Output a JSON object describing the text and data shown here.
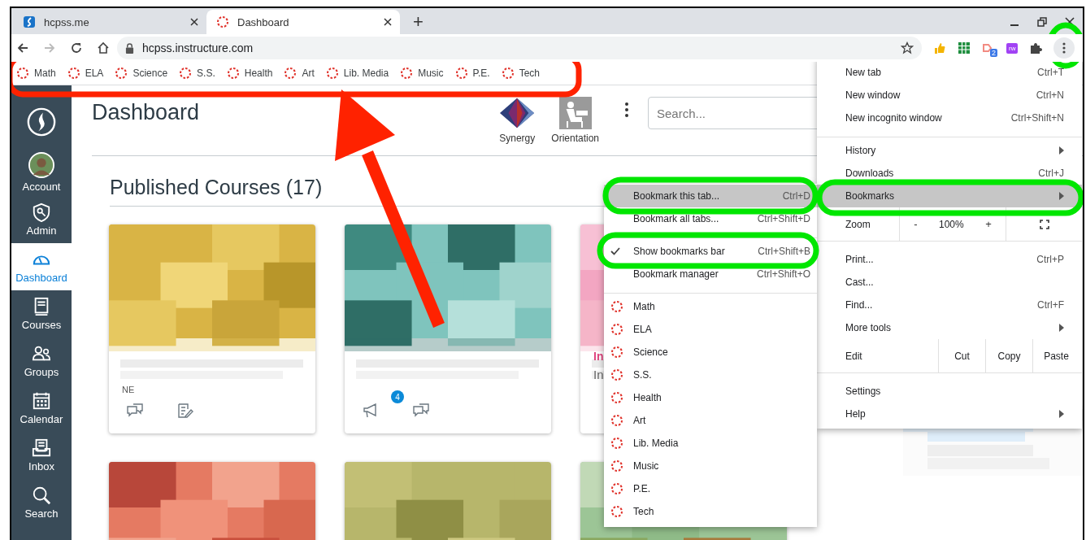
{
  "browser": {
    "tabs": [
      {
        "title": "hcpss.me",
        "selected": false
      },
      {
        "title": "Dashboard",
        "selected": true
      }
    ],
    "new_tab": "+",
    "address": "hcpss.instructure.com",
    "extensions": [
      {
        "kind": "thumb"
      },
      {
        "kind": "grid"
      },
      {
        "kind": "shape",
        "badge": "2"
      },
      {
        "kind": "rw",
        "label": "rw"
      },
      {
        "kind": "puzzle"
      }
    ]
  },
  "bookmarks_bar": [
    {
      "label": "Math"
    },
    {
      "label": "ELA"
    },
    {
      "label": "Science"
    },
    {
      "label": "S.S."
    },
    {
      "label": "Health"
    },
    {
      "label": "Art"
    },
    {
      "label": "Lib. Media"
    },
    {
      "label": "Music"
    },
    {
      "label": "P.E."
    },
    {
      "label": "Tech"
    }
  ],
  "sidebar": {
    "items": [
      {
        "kind": "account",
        "label": "Account",
        "selected": false
      },
      {
        "kind": "admin",
        "label": "Admin",
        "selected": false
      },
      {
        "kind": "dashboard",
        "label": "Dashboard",
        "selected": true
      },
      {
        "kind": "courses",
        "label": "Courses",
        "selected": false
      },
      {
        "kind": "groups",
        "label": "Groups",
        "selected": false
      },
      {
        "kind": "calendar",
        "label": "Calendar",
        "selected": false
      },
      {
        "kind": "inbox",
        "label": "Inbox",
        "selected": false
      },
      {
        "kind": "search",
        "label": "Search",
        "selected": false
      }
    ]
  },
  "page": {
    "title": "Dashboard",
    "apps": [
      {
        "kind": "synergy",
        "label": "Synergy"
      },
      {
        "kind": "orientation",
        "label": "Orientation"
      }
    ],
    "search": {
      "placeholder": "Search..."
    },
    "section_title": "Published Courses (17)",
    "cards": [
      {
        "kind": "course",
        "term": "NE",
        "actions": [
          {
            "kind": "discussion"
          },
          {
            "kind": "assignment"
          }
        ]
      },
      {
        "kind": "course",
        "actions": [
          {
            "kind": "announcement",
            "badge": "4"
          },
          {
            "kind": "discussion"
          }
        ]
      },
      {
        "kind": "course",
        "title": "In",
        "subtitle": "In"
      },
      {
        "kind": "course"
      },
      {
        "kind": "course"
      },
      {
        "kind": "course"
      }
    ]
  },
  "app_menu": {
    "items": [
      {
        "kind": "item",
        "label": "New tab",
        "shortcut": "Ctrl+T",
        "selected": false
      },
      {
        "kind": "item",
        "label": "New window",
        "shortcut": "Ctrl+N",
        "selected": false
      },
      {
        "kind": "item",
        "label": "New incognito window",
        "shortcut": "Ctrl+Shift+N",
        "selected": false
      },
      {
        "kind": "separator"
      },
      {
        "kind": "submenu",
        "label": "History",
        "selected": false
      },
      {
        "kind": "item",
        "label": "Downloads",
        "shortcut": "Ctrl+J",
        "selected": false
      },
      {
        "kind": "submenu",
        "label": "Bookmarks",
        "selected": true
      },
      {
        "kind": "zoom",
        "label": "Zoom",
        "minus": "-",
        "value": "100%",
        "plus": "+"
      },
      {
        "kind": "item",
        "label": "Print...",
        "shortcut": "Ctrl+P",
        "selected": false
      },
      {
        "kind": "item",
        "label": "Cast...",
        "selected": false
      },
      {
        "kind": "item",
        "label": "Find...",
        "shortcut": "Ctrl+F",
        "selected": false
      },
      {
        "kind": "submenu",
        "label": "More tools",
        "selected": false
      },
      {
        "kind": "edit",
        "label": "Edit",
        "actions": [
          "Cut",
          "Copy",
          "Paste"
        ]
      },
      {
        "kind": "item",
        "label": "Settings",
        "selected": false
      },
      {
        "kind": "submenu",
        "label": "Help",
        "selected": false
      }
    ]
  },
  "bookmarks_menu": {
    "items": [
      {
        "kind": "action",
        "label": "Bookmark this tab...",
        "shortcut": "Ctrl+D",
        "checked": false,
        "selected": true
      },
      {
        "kind": "action",
        "label": "Bookmark all tabs...",
        "shortcut": "Ctrl+Shift+D",
        "checked": false,
        "selected": false
      },
      {
        "kind": "separator"
      },
      {
        "kind": "action",
        "label": "Show bookmarks bar",
        "shortcut": "Ctrl+Shift+B",
        "checked": true,
        "selected": false
      },
      {
        "kind": "action",
        "label": "Bookmark manager",
        "shortcut": "Ctrl+Shift+O",
        "checked": false,
        "selected": false
      },
      {
        "kind": "separator"
      },
      {
        "kind": "bookmark",
        "label": "Math"
      },
      {
        "kind": "bookmark",
        "label": "ELA"
      },
      {
        "kind": "bookmark",
        "label": "Science"
      },
      {
        "kind": "bookmark",
        "label": "S.S."
      },
      {
        "kind": "bookmark",
        "label": "Health"
      },
      {
        "kind": "bookmark",
        "label": "Art"
      },
      {
        "kind": "bookmark",
        "label": "Lib. Media"
      },
      {
        "kind": "bookmark",
        "label": "Music"
      },
      {
        "kind": "bookmark",
        "label": "P.E."
      },
      {
        "kind": "bookmark",
        "label": "Tech"
      }
    ]
  },
  "annotations": [
    {
      "kind": "outline",
      "color": "#ff2200"
    },
    {
      "kind": "arrow",
      "color": "#ff2200"
    },
    {
      "kind": "outline",
      "color": "#00e600"
    },
    {
      "kind": "outline",
      "color": "#00e600"
    },
    {
      "kind": "outline",
      "color": "#00e600"
    },
    {
      "kind": "outline",
      "color": "#00e600"
    }
  ]
}
